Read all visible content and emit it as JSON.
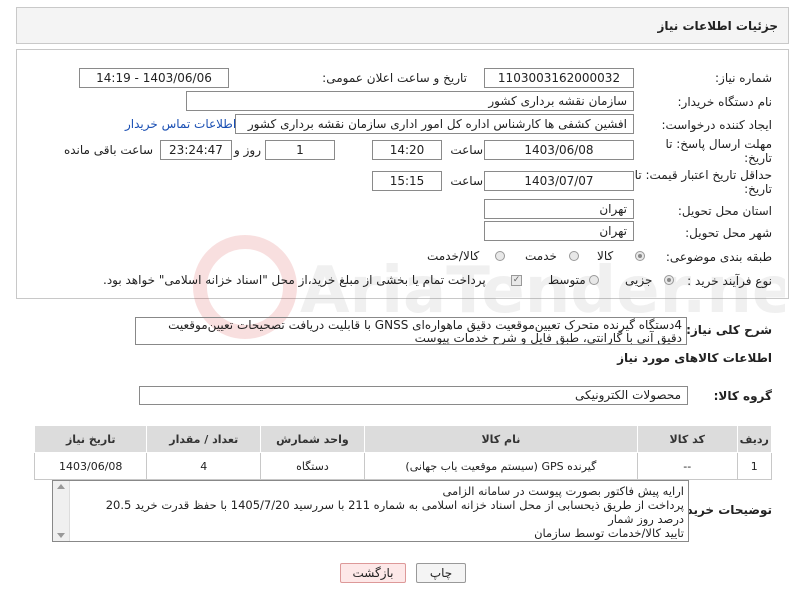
{
  "header": {
    "title": "جزئیات اطلاعات نیاز"
  },
  "form": {
    "need_number": {
      "label": "شماره نیاز:",
      "value": "1103003162000032"
    },
    "announce_datetime": {
      "label": "تاریخ و ساعت اعلان عمومی:",
      "value": "1403/06/06 - 14:19"
    },
    "buyer_org": {
      "label": "نام دستگاه خریدار:",
      "value": "سازمان نقشه برداری کشور"
    },
    "requester": {
      "label": "ایجاد کننده درخواست:",
      "value": "افشین کشفی ها کارشناس اداره کل امور اداری سازمان نقشه برداری کشور",
      "contact_link": "اطلاعات تماس خریدار"
    },
    "reply_deadline": {
      "label_line1": "مهلت ارسال پاسخ: تا",
      "label_line2": "تاریخ:",
      "date": "1403/06/08",
      "time_label": "ساعت",
      "time": "14:20",
      "days": "1",
      "days_label": "روز و",
      "remaining_time": "23:24:47",
      "remaining_label": "ساعت باقی مانده"
    },
    "price_validity": {
      "label_line1": "حداقل تاریخ اعتبار قیمت: تا",
      "label_line2": "تاریخ:",
      "date": "1403/07/07",
      "time_label": "ساعت",
      "time": "15:15"
    },
    "delivery_province": {
      "label": "استان محل تحویل:",
      "value": "تهران"
    },
    "delivery_city": {
      "label": "شهر محل تحویل:",
      "value": "تهران"
    },
    "category": {
      "label": "طبقه بندی موضوعی:",
      "options": [
        "کالا",
        "خدمت",
        "کالا/خدمت"
      ],
      "selected": "کالا"
    },
    "purchase_type": {
      "label": "نوع فرآیند خرید :",
      "options": [
        "جزیی",
        "متوسط"
      ],
      "selected": "جزیی",
      "payment_note": "پرداخت تمام یا بخشی از مبلغ خرید،از محل \"اسناد خزانه اسلامی\" خواهد بود."
    }
  },
  "description": {
    "label": "شرح کلی نیاز:",
    "text": "4دستگاه گیرنده متحرک تعیین‌موقعیت دقیق ماهواره‌ای GNSS با قابلیت دریافت تصحیحات تعیین‌موقعیت دقیق آنی با گارانتی، طبق فایل و شرح خدمات پیوست"
  },
  "goods_info": {
    "section_title": "اطلاعات کالاهای مورد نیاز",
    "group_label": "گروه کالا:",
    "group_value": "محصولات الکترونیکی",
    "columns": [
      "ردیف",
      "کد کالا",
      "نام کالا",
      "واحد شمارش",
      "تعداد / مقدار",
      "تاریخ نیاز"
    ],
    "rows": [
      [
        "1",
        "--",
        "گیرنده GPS (سیستم موقعیت یاب جهانی)",
        "دستگاه",
        "4",
        "1403/06/08"
      ]
    ]
  },
  "buyer_notes": {
    "label": "توضیحات خریدار:",
    "line1": "ارایه پیش فاکتور بصورت پیوست در سامانه الزامی",
    "line2": "پرداخت از طریق ذیحسابی از محل اسناد خزانه اسلامی به شماره 211 با سررسید  1405/7/20 با حفظ قدرت خرید 20.5",
    "line3": "درصد روز شمار",
    "line4": "تایید کالا/خدمات توسط سازمان"
  },
  "buttons": {
    "print": "چاپ",
    "back": "بازگشت"
  },
  "watermark": {
    "text": "AriaTender.neT"
  }
}
